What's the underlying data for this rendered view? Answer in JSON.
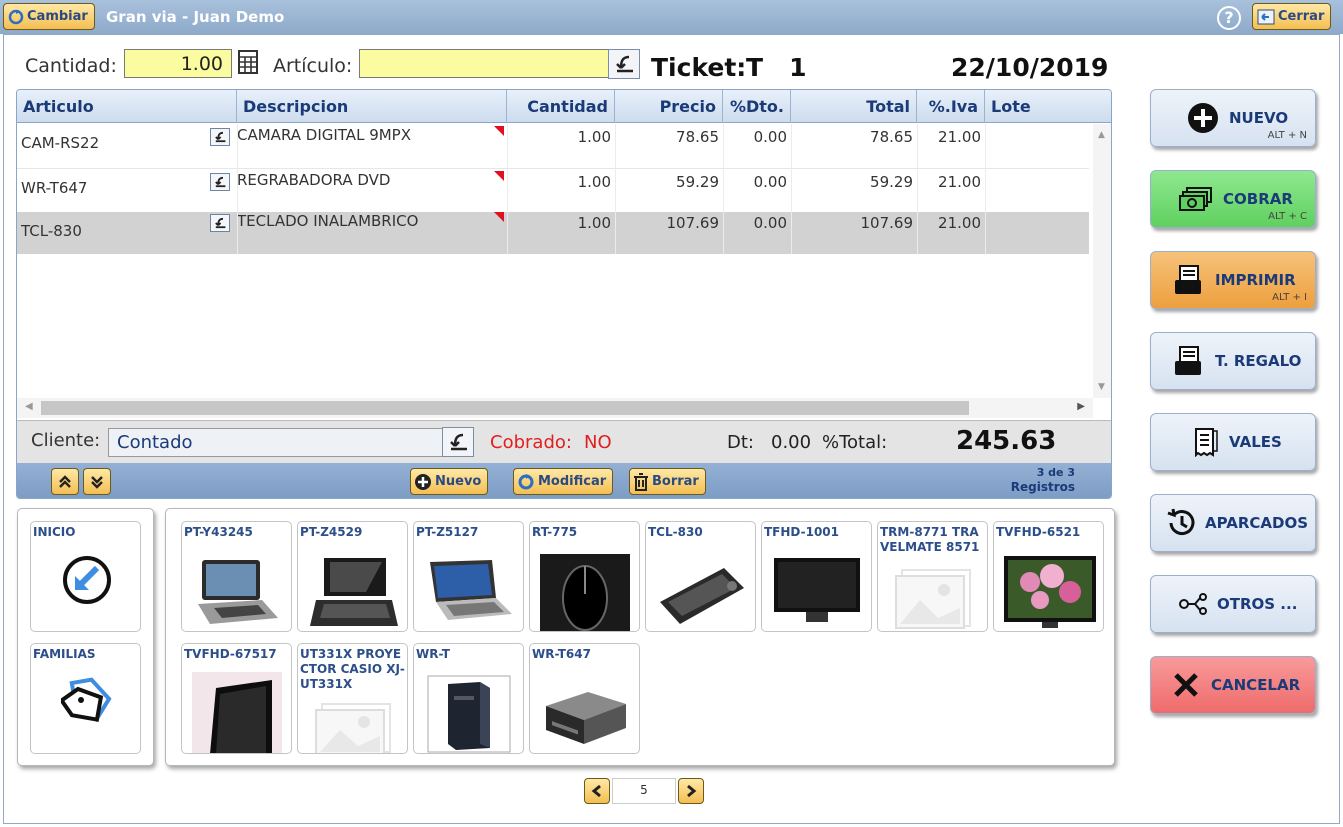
{
  "titlebar": {
    "change_label": "Cambiar",
    "title": "Gran via - Juan Demo",
    "help_icon": "?",
    "close_label": "Cerrar"
  },
  "entry": {
    "quantity_label": "Cantidad:",
    "quantity_value": "1.00",
    "article_label": "Artículo:",
    "article_value": "",
    "ticket_label": "Ticket:",
    "ticket_number": "T   1",
    "date": "22/10/2019"
  },
  "grid": {
    "columns": [
      "Articulo",
      "Descripcion",
      "Cantidad",
      "Precio",
      "%Dto.",
      "Total",
      "%.Iva",
      "Lote"
    ],
    "rows": [
      {
        "articulo": "CAM-RS22",
        "descripcion": "CAMARA DIGITAL 9MPX",
        "cantidad": "1.00",
        "precio": "78.65",
        "dto": "0.00",
        "total": "78.65",
        "iva": "21.00",
        "lote": ""
      },
      {
        "articulo": "WR-T647",
        "descripcion": "REGRABADORA DVD",
        "cantidad": "1.00",
        "precio": "59.29",
        "dto": "0.00",
        "total": "59.29",
        "iva": "21.00",
        "lote": ""
      },
      {
        "articulo": "TCL-830",
        "descripcion": "TECLADO INALAMBRICO",
        "cantidad": "1.00",
        "precio": "107.69",
        "dto": "0.00",
        "total": "107.69",
        "iva": "21.00",
        "lote": ""
      }
    ],
    "selected_row": 2
  },
  "footer": {
    "client_label": "Cliente:",
    "client_value": "Contado",
    "charged_label": "Cobrado:",
    "charged_value": "NO",
    "discount_label": "Dt:",
    "discount_value": "0.00",
    "total_label": "%Total:",
    "total_value": "245.63"
  },
  "grid_toolbar": {
    "new_label": "Nuevo",
    "modify_label": "Modificar",
    "delete_label": "Borrar",
    "records_count": "3 de 3",
    "records_label": "Registros"
  },
  "nav_tiles": [
    {
      "label": "INICIO",
      "icon": "home-arrow-icon"
    },
    {
      "label": "FAMILIAS",
      "icon": "tags-icon"
    }
  ],
  "products": [
    {
      "label": "PT-Y43245",
      "image": "tablet-laptop"
    },
    {
      "label": "PT-Z4529",
      "image": "laptop-dark"
    },
    {
      "label": "PT-Z5127",
      "image": "laptop-silver"
    },
    {
      "label": "RT-775",
      "image": "mouse"
    },
    {
      "label": "TCL-830",
      "image": "keyboard"
    },
    {
      "label": "TFHD-1001",
      "image": "tv"
    },
    {
      "label": "TRM-8771 TRAVELMATE 8571",
      "image": "placeholder"
    },
    {
      "label": "TVFHD-6521",
      "image": "tv-flowers"
    },
    {
      "label": "TVFHD-67517",
      "image": "tv-black"
    },
    {
      "label": "UT331X PROYECTOR CASIO XJ-UT331X",
      "image": "placeholder"
    },
    {
      "label": "WR-T",
      "image": "tower-drive"
    },
    {
      "label": "WR-T647",
      "image": "dvd-drive"
    }
  ],
  "pager": {
    "page": "5"
  },
  "side_buttons": [
    {
      "label": "NUEVO",
      "shortcut": "ALT + N",
      "icon": "plus-circle-icon",
      "color": "#dde7f3"
    },
    {
      "label": "COBRAR",
      "shortcut": "ALT + C",
      "icon": "money-icon",
      "color": "#6fda6f"
    },
    {
      "label": "IMPRIMIR",
      "shortcut": "ALT + I",
      "icon": "printer-icon",
      "color": "#f2ad55"
    },
    {
      "label": "T. REGALO",
      "shortcut": "",
      "icon": "printer-icon",
      "color": "#dde7f3"
    },
    {
      "label": "VALES",
      "shortcut": "",
      "icon": "receipt-icon",
      "color": "#dde7f3"
    },
    {
      "label": "APARCADOS",
      "shortcut": "",
      "icon": "history-icon",
      "color": "#dde7f3"
    },
    {
      "label": "OTROS ...",
      "shortcut": "",
      "icon": "share-icon",
      "color": "#dde7f3"
    },
    {
      "label": "CANCELAR",
      "shortcut": "",
      "icon": "close-icon",
      "color": "#f27b7b"
    }
  ]
}
